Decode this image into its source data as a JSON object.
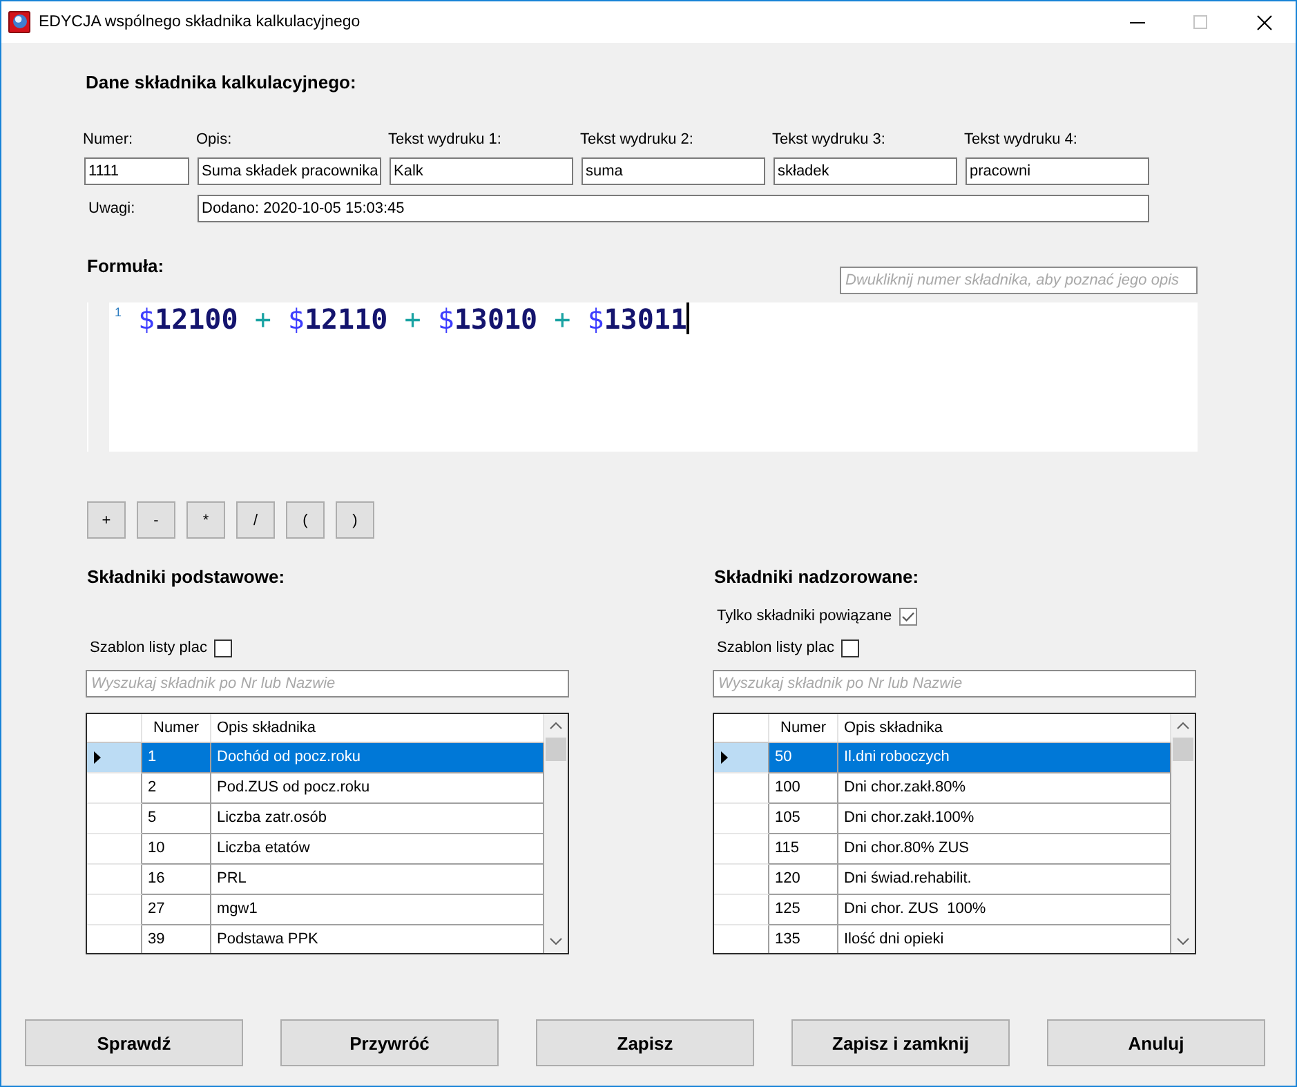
{
  "window": {
    "title": "EDYCJA wspólnego składnika kalkulacyjnego",
    "maximize_disabled": true
  },
  "details": {
    "heading": "Dane składnika kalkulacyjnego:",
    "fields": [
      {
        "label": "Numer:",
        "value": "1111"
      },
      {
        "label": "Opis:",
        "value": "Suma składek pracownika"
      },
      {
        "label": "Tekst wydruku 1:",
        "value": "Kalk"
      },
      {
        "label": "Tekst wydruku 2:",
        "value": "suma"
      },
      {
        "label": "Tekst wydruku 3:",
        "value": "składek"
      },
      {
        "label": "Tekst wydruku 4:",
        "value": "pracowni"
      }
    ],
    "notes": {
      "label": "Uwagi:",
      "value": "Dodano: 2020-10-05 15:03:45"
    }
  },
  "formula": {
    "heading": "Formuła:",
    "hint": {
      "placeholder": "Dwukliknij numer składnika, aby poznać jego opis"
    },
    "editor": {
      "line_number": "1",
      "focused": true,
      "tokens": [
        {
          "kind": "reference",
          "sigil": "$",
          "number": "12100"
        },
        {
          "kind": "operator",
          "text": "+"
        },
        {
          "kind": "reference",
          "sigil": "$",
          "number": "12110"
        },
        {
          "kind": "operator",
          "text": "+"
        },
        {
          "kind": "reference",
          "sigil": "$",
          "number": "13010"
        },
        {
          "kind": "operator",
          "text": "+"
        },
        {
          "kind": "reference",
          "sigil": "$",
          "number": "13011"
        }
      ]
    }
  },
  "operator_buttons": [
    "+",
    "-",
    "*",
    "/",
    "(",
    ")"
  ],
  "basic_components": {
    "heading": "Składniki podstawowe:",
    "options": [
      {
        "label": "Szablon listy plac",
        "checked": false
      }
    ],
    "search": {
      "placeholder": "Wyszukaj składnik po Nr lub Nazwie"
    },
    "table": {
      "columns": [
        "Numer",
        "Opis składnika"
      ],
      "rows": [
        {
          "number": "1",
          "description": "Dochód od pocz.roku",
          "selected": true
        },
        {
          "number": "2",
          "description": "Pod.ZUS od pocz.roku",
          "selected": false
        },
        {
          "number": "5",
          "description": "Liczba zatr.osób",
          "selected": false
        },
        {
          "number": "10",
          "description": "Liczba etatów",
          "selected": false
        },
        {
          "number": "16",
          "description": "PRL",
          "selected": false
        },
        {
          "number": "27",
          "description": "mgw1",
          "selected": false
        },
        {
          "number": "39",
          "description": "Podstawa PPK",
          "selected": false
        }
      ]
    }
  },
  "supervised_components": {
    "heading": "Składniki nadzorowane:",
    "options": [
      {
        "label": "Tylko składniki powiązane",
        "checked": true
      },
      {
        "label": "Szablon listy plac",
        "checked": false
      }
    ],
    "search": {
      "placeholder": "Wyszukaj składnik po Nr lub Nazwie"
    },
    "table": {
      "columns": [
        "Numer",
        "Opis składnika"
      ],
      "rows": [
        {
          "number": "50",
          "description": "Il.dni roboczych",
          "selected": true
        },
        {
          "number": "100",
          "description": "Dni chor.zakł.80%",
          "selected": false
        },
        {
          "number": "105",
          "description": "Dni chor.zakł.100%",
          "selected": false
        },
        {
          "number": "115",
          "description": "Dni chor.80% ZUS",
          "selected": false
        },
        {
          "number": "120",
          "description": "Dni świad.rehabilit.",
          "selected": false
        },
        {
          "number": "125",
          "description": "Dni chor. ZUS  100%",
          "selected": false
        },
        {
          "number": "135",
          "description": "Ilość dni opieki",
          "selected": false
        }
      ]
    }
  },
  "buttons": [
    "Sprawdź",
    "Przywróć",
    "Zapisz",
    "Zapisz i zamknij",
    "Anuluj"
  ]
}
